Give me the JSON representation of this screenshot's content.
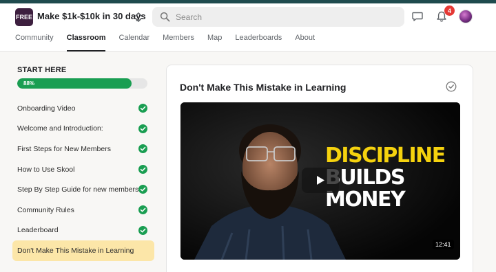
{
  "header": {
    "logo_text": "FREE",
    "group_name": "Make $1k-$10k in 30 days",
    "search_placeholder": "Search",
    "notification_count": "4"
  },
  "tabs": [
    {
      "label": "Community",
      "active": false
    },
    {
      "label": "Classroom",
      "active": true
    },
    {
      "label": "Calendar",
      "active": false
    },
    {
      "label": "Members",
      "active": false
    },
    {
      "label": "Map",
      "active": false
    },
    {
      "label": "Leaderboards",
      "active": false
    },
    {
      "label": "About",
      "active": false
    }
  ],
  "course": {
    "module_title": "START HERE",
    "progress_label": "88%",
    "progress": 0.88,
    "lessons": [
      {
        "title": "Onboarding Video",
        "completed": true
      },
      {
        "title": "Welcome and Introduction:",
        "completed": true
      },
      {
        "title": "First Steps for New Members",
        "completed": true
      },
      {
        "title": "How to Use Skool",
        "completed": true
      },
      {
        "title": "Step By Step Guide for new members",
        "completed": true
      },
      {
        "title": "Community Rules",
        "completed": true
      },
      {
        "title": "Leaderboard",
        "completed": true
      },
      {
        "title": "Don't Make This Mistake in Learning",
        "completed": false,
        "active": true
      }
    ]
  },
  "lesson": {
    "title": "Don't Make This Mistake in Learning",
    "video": {
      "thumbnail_lines": [
        "DISCIPLINE",
        "BUILDS",
        "MONEY"
      ],
      "duration": "12:41"
    }
  },
  "colors": {
    "brand_stripe": "#1f4b4e",
    "progress_green": "#1a9e52",
    "active_lesson_bg": "#fce6a8",
    "badge_red": "#e53935",
    "thumbnail_yellow": "#f5d20e"
  },
  "icons": [
    "switch-group-icon",
    "search-icon",
    "chat-icon",
    "bell-icon",
    "check-circle-icon",
    "mark-complete-icon",
    "play-icon"
  ]
}
